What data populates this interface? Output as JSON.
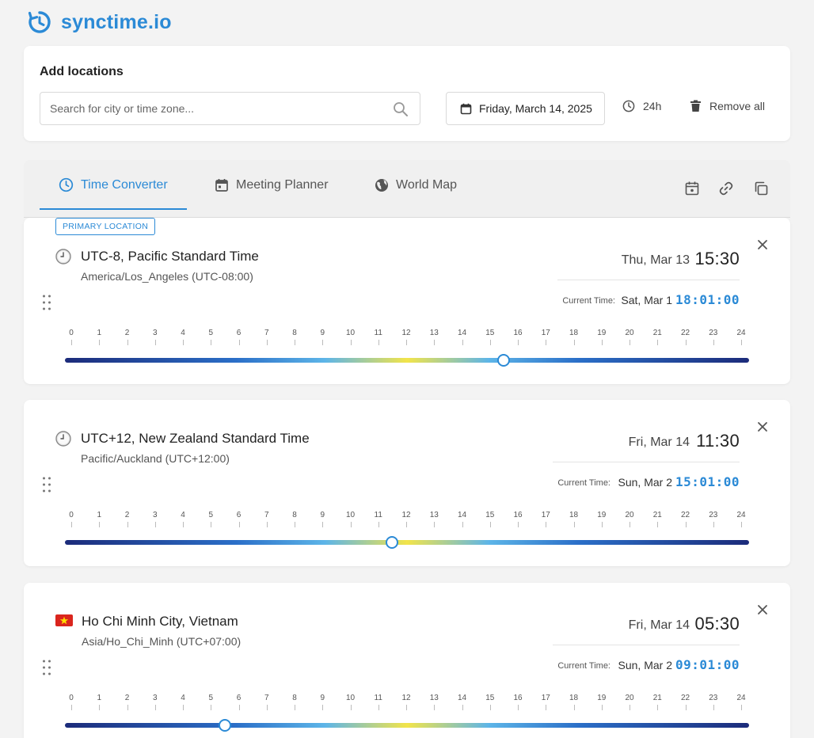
{
  "app": {
    "logo_text": "synctime.io"
  },
  "add_locations": {
    "title": "Add locations",
    "search_placeholder": "Search for city or time zone...",
    "date_label": "Friday, March 14, 2025",
    "format_label": "24h",
    "remove_all_label": "Remove all"
  },
  "tabs": [
    {
      "label": "Time Converter",
      "active": true
    },
    {
      "label": "Meeting Planner",
      "active": false
    },
    {
      "label": "World Map",
      "active": false
    }
  ],
  "hour_ticks": [
    "0",
    "1",
    "2",
    "3",
    "4",
    "5",
    "6",
    "7",
    "8",
    "9",
    "10",
    "11",
    "12",
    "13",
    "14",
    "15",
    "16",
    "17",
    "18",
    "19",
    "20",
    "21",
    "22",
    "23",
    "24"
  ],
  "current_time_label": "Current Time:",
  "locations": [
    {
      "badge": "PRIMARY LOCATION",
      "icon": "clock-emoji-icon",
      "name": "UTC-8, Pacific Standard Time",
      "zone": "America/Los_Angeles (UTC-08:00)",
      "selected_date": "Thu, Mar 13",
      "selected_time": "15:30",
      "current_date": "Sat, Mar 1",
      "current_time": "18:01:00",
      "slider_hour": 15.5
    },
    {
      "badge": "",
      "icon": "clock-emoji-icon",
      "name": "UTC+12, New Zealand Standard Time",
      "zone": "Pacific/Auckland (UTC+12:00)",
      "selected_date": "Fri, Mar 14",
      "selected_time": "11:30",
      "current_date": "Sun, Mar 2",
      "current_time": "15:01:00",
      "slider_hour": 11.5
    },
    {
      "badge": "",
      "icon": "vietnam-flag-icon",
      "name": "Ho Chi Minh City, Vietnam",
      "zone": "Asia/Ho_Chi_Minh (UTC+07:00)",
      "selected_date": "Fri, Mar 14",
      "selected_time": "05:30",
      "current_date": "Sun, Mar 2",
      "current_time": "09:01:00",
      "slider_hour": 5.5
    }
  ],
  "colors": {
    "accent": "#2b8ad6",
    "background": "#f3f3f3"
  }
}
